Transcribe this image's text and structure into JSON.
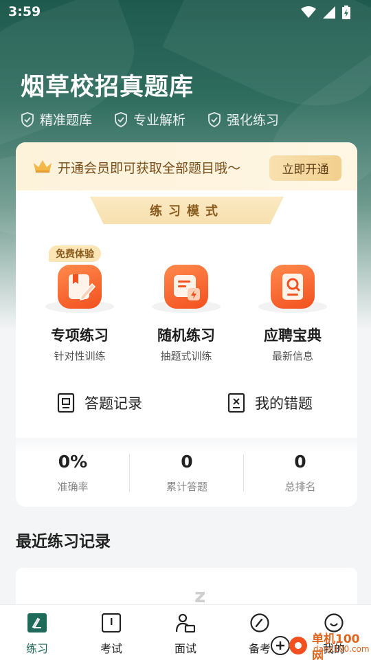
{
  "status_bar": {
    "time": "3:59"
  },
  "header": {
    "title": "烟草校招真题库",
    "features": [
      "精准题库",
      "专业解析",
      "强化练习"
    ]
  },
  "vip": {
    "text": "开通会员即可获取全部题目哦～",
    "button": "立即开通"
  },
  "practice": {
    "section_title": "练习模式",
    "modes": [
      {
        "title": "专项练习",
        "subtitle": "针对性训练",
        "badge": "免费体验"
      },
      {
        "title": "随机练习",
        "subtitle": "抽题式训练"
      },
      {
        "title": "应聘宝典",
        "subtitle": "最新信息"
      }
    ],
    "links": {
      "records": "答题记录",
      "mistakes": "我的错题"
    }
  },
  "stats": [
    {
      "value": "0%",
      "label": "准确率"
    },
    {
      "value": "0",
      "label": "累计答题"
    },
    {
      "value": "0",
      "label": "总排名"
    }
  ],
  "recent": {
    "title": "最近练习记录",
    "empty_mark": "z"
  },
  "tabbar": {
    "active": 0,
    "items": [
      "练习",
      "考试",
      "面试",
      "备考",
      "我的"
    ]
  },
  "watermark": {
    "text": "单机100网",
    "url": "danji100.com"
  },
  "colors": {
    "accent": "#1f6b5a",
    "orange": "#f2501f",
    "gold": "#8a5a1c"
  }
}
